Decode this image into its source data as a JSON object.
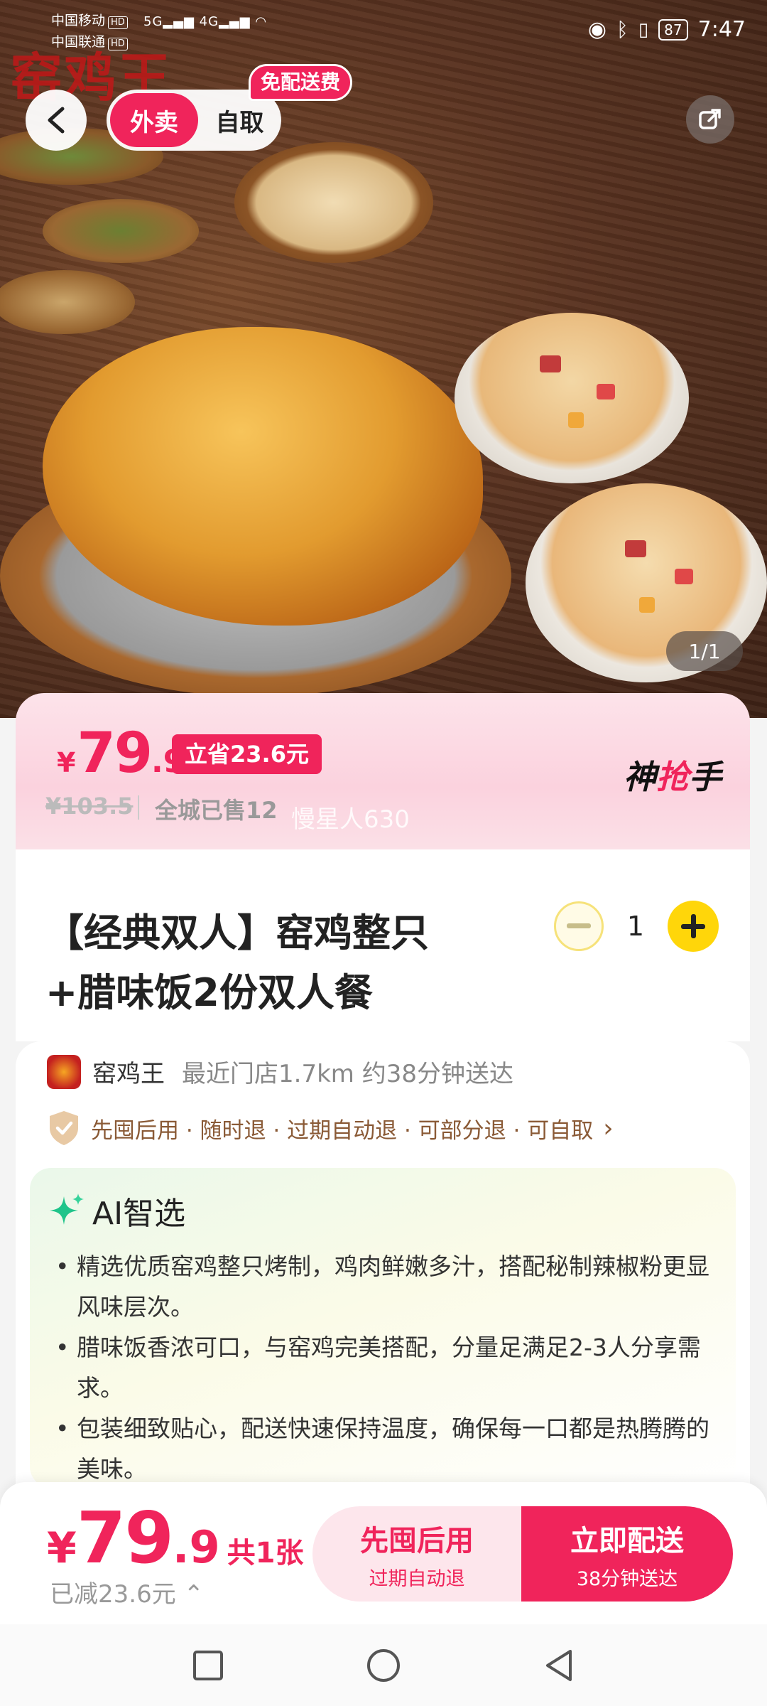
{
  "status_bar": {
    "carrier1": "中国移动",
    "carrier2": "中国联通",
    "hd_tag": "HD",
    "network": "5G",
    "network2": "4G",
    "battery": "87",
    "time": "7:47"
  },
  "hero": {
    "brand_text": "窑鸡王",
    "page_indicator": "1/1"
  },
  "header": {
    "mode_active": "外卖",
    "mode_other": "自取",
    "free_delivery": "免配送费"
  },
  "price": {
    "symbol": "¥",
    "integer": "79",
    "decimal": ".9",
    "save_badge": "立省23.6元",
    "original": "¥103.5",
    "sold": "全城已售12",
    "watermark": "慢星人630",
    "brand_left": "神",
    "brand_mid": "抢",
    "brand_right": "手"
  },
  "product": {
    "title_line1": "【经典双人】窑鸡整只",
    "title_line2": "+腊味饭2份双人餐",
    "quantity": "1"
  },
  "store": {
    "name": "窑鸡王",
    "meta": "最近门店1.7km   约38分钟送达",
    "policy": "先囤后用 · 随时退 · 过期自动退 · 可部分退 · 可自取",
    "policy_arrow": "›"
  },
  "ai": {
    "title": "AI智选",
    "points": [
      "精选优质窑鸡整只烤制，鸡肉鲜嫩多汁，搭配秘制辣椒粉更显风味层次。",
      "腊味饭香浓可口，与窑鸡完美搭配，分量足满足2-3人分享需求。",
      "包装细致贴心，配送快速保持温度，确保每一口都是热腾腾的美味。"
    ]
  },
  "bottom": {
    "symbol": "¥",
    "integer": "79",
    "decimal": ".9",
    "count": "共1张",
    "reduced": "已减23.6元 ⌃",
    "left_main": "先囤后用",
    "left_sub": "过期自动退",
    "right_main": "立即配送",
    "right_sub": "38分钟送达"
  },
  "colors": {
    "accent": "#f0245b",
    "plus_button": "#ffd60a"
  }
}
